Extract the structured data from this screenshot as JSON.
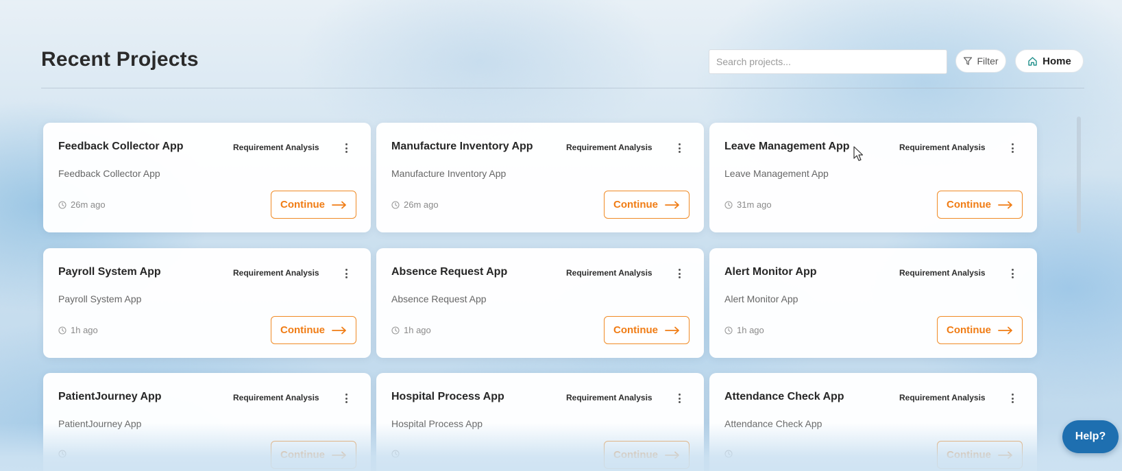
{
  "header": {
    "title": "Recent Projects",
    "search_placeholder": "Search projects...",
    "search_value": "",
    "filter_label": "Filter",
    "home_label": "Home"
  },
  "projects": [
    {
      "title": "Feedback Collector App",
      "stage": "Requirement Analysis",
      "description": "Feedback Collector App",
      "time": "26m ago",
      "action": "Continue"
    },
    {
      "title": "Manufacture Inventory App",
      "stage": "Requirement Analysis",
      "description": "Manufacture Inventory App",
      "time": "26m ago",
      "action": "Continue"
    },
    {
      "title": "Leave Management App",
      "stage": "Requirement Analysis",
      "description": "Leave Management App",
      "time": "31m ago",
      "action": "Continue"
    },
    {
      "title": "Payroll System App",
      "stage": "Requirement Analysis",
      "description": "Payroll System App",
      "time": "1h ago",
      "action": "Continue"
    },
    {
      "title": "Absence Request App",
      "stage": "Requirement Analysis",
      "description": "Absence Request App",
      "time": "1h ago",
      "action": "Continue"
    },
    {
      "title": "Alert Monitor App",
      "stage": "Requirement Analysis",
      "description": "Alert Monitor App",
      "time": "1h ago",
      "action": "Continue"
    },
    {
      "title": "PatientJourney App",
      "stage": "Requirement Analysis",
      "description": "PatientJourney App",
      "time": "",
      "action": "Continue"
    },
    {
      "title": "Hospital Process App",
      "stage": "Requirement Analysis",
      "description": "Hospital Process App",
      "time": "",
      "action": "Continue"
    },
    {
      "title": "Attendance Check App",
      "stage": "Requirement Analysis",
      "description": "Attendance Check App",
      "time": "",
      "action": "Continue"
    }
  ],
  "help_label": "Help?",
  "colors": {
    "accent": "#f07c14",
    "help": "#1e6fb0",
    "title": "#262626"
  },
  "icons": [
    "filter-icon",
    "home-icon",
    "more-vertical-icon",
    "clock-icon",
    "arrow-right-icon"
  ]
}
